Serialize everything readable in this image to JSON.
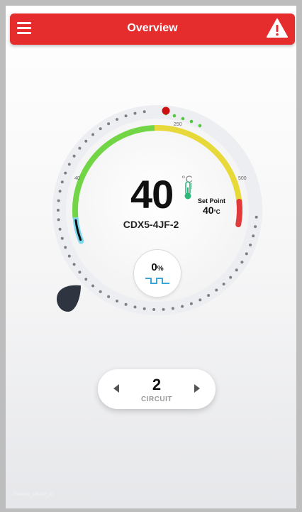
{
  "header": {
    "title": "Overview",
    "menu_icon": "hamburger-menu-icon",
    "alert_icon": "warning-triangle-icon"
  },
  "gauge": {
    "value": "40",
    "unit": "°C",
    "scale_labels": [
      "40",
      "250",
      "500"
    ],
    "setpoint_label": "Set Point",
    "setpoint_value": "40",
    "setpoint_unit": "°C",
    "model": "CDX5-4JF-2",
    "zones": [
      "#7dd8ef",
      "#72d545",
      "#e8d93a",
      "#e23a3a"
    ],
    "indicator_color": "#cc1010"
  },
  "output": {
    "value": "0",
    "unit": "%"
  },
  "circuit": {
    "number": "2",
    "label": "CIRCUIT"
  },
  "footer": {
    "text": "Thermon_180402_01"
  }
}
